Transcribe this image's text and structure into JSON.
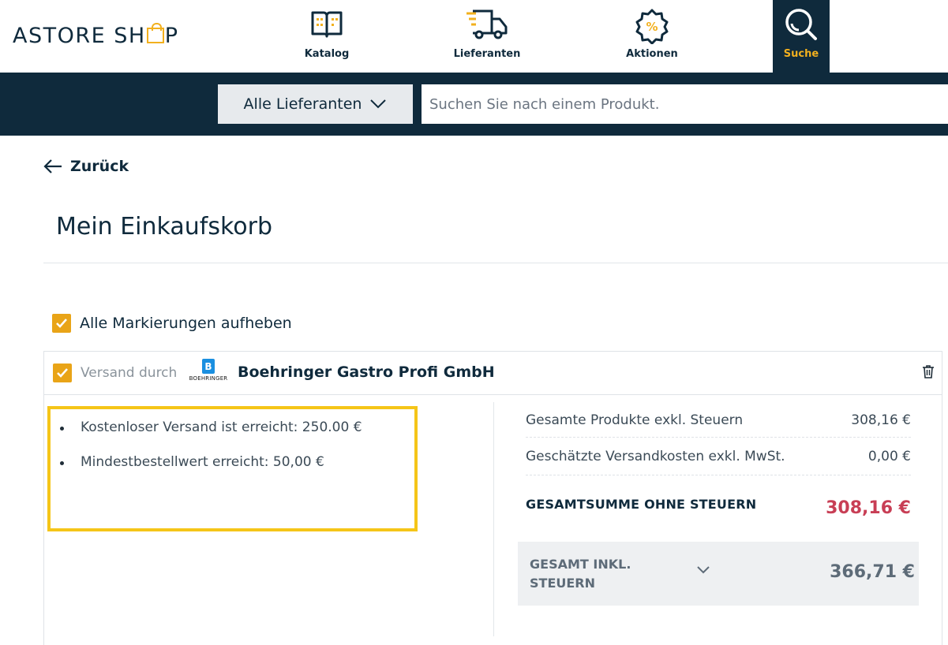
{
  "brand": {
    "logo_left": "ASTORE SH",
    "logo_right": "P"
  },
  "nav": {
    "katalog": "Katalog",
    "lieferanten": "Lieferanten",
    "aktionen": "Aktionen",
    "suche": "Suche"
  },
  "search": {
    "supplier_filter": "Alle Lieferanten",
    "placeholder": "Suchen Sie nach einem Produkt."
  },
  "back_label": "Zurück",
  "page_title": "Mein Einkaufskorb",
  "select_all_label": "Alle Markierungen aufheben",
  "supplier": {
    "ship_label": "Versand durch",
    "logo_letter": "B",
    "logo_text": "BOEHRINGER",
    "name": "Boehringer Gastro Profi GmbH",
    "notes": [
      "Kostenloser Versand ist erreicht: 250.00 €",
      "Mindestbestellwert erreicht: 50,00 €"
    ]
  },
  "summary": {
    "products_label": "Gesamte Produkte exkl. Steuern",
    "products_value": "308,16 €",
    "shipping_label": "Geschätzte Versandkosten exkl. MwSt.",
    "shipping_value": "0,00 €",
    "total_label": "GESAMTSUMME OHNE STEUERN",
    "total_value": "308,16 €",
    "gross_label": "GESAMT INKL. STEUERN",
    "gross_value": "366,71 €"
  },
  "colors": {
    "navy": "#0f2a3c",
    "accent_yellow": "#f2b01e",
    "checkbox": "#e9a417",
    "highlight_border": "#f5c518",
    "total_red": "#c83e55"
  },
  "icons": [
    "book-icon",
    "truck-icon",
    "discount-badge-icon",
    "search-icon",
    "chevron-down-icon",
    "arrow-left-icon",
    "check-icon",
    "trash-icon"
  ]
}
